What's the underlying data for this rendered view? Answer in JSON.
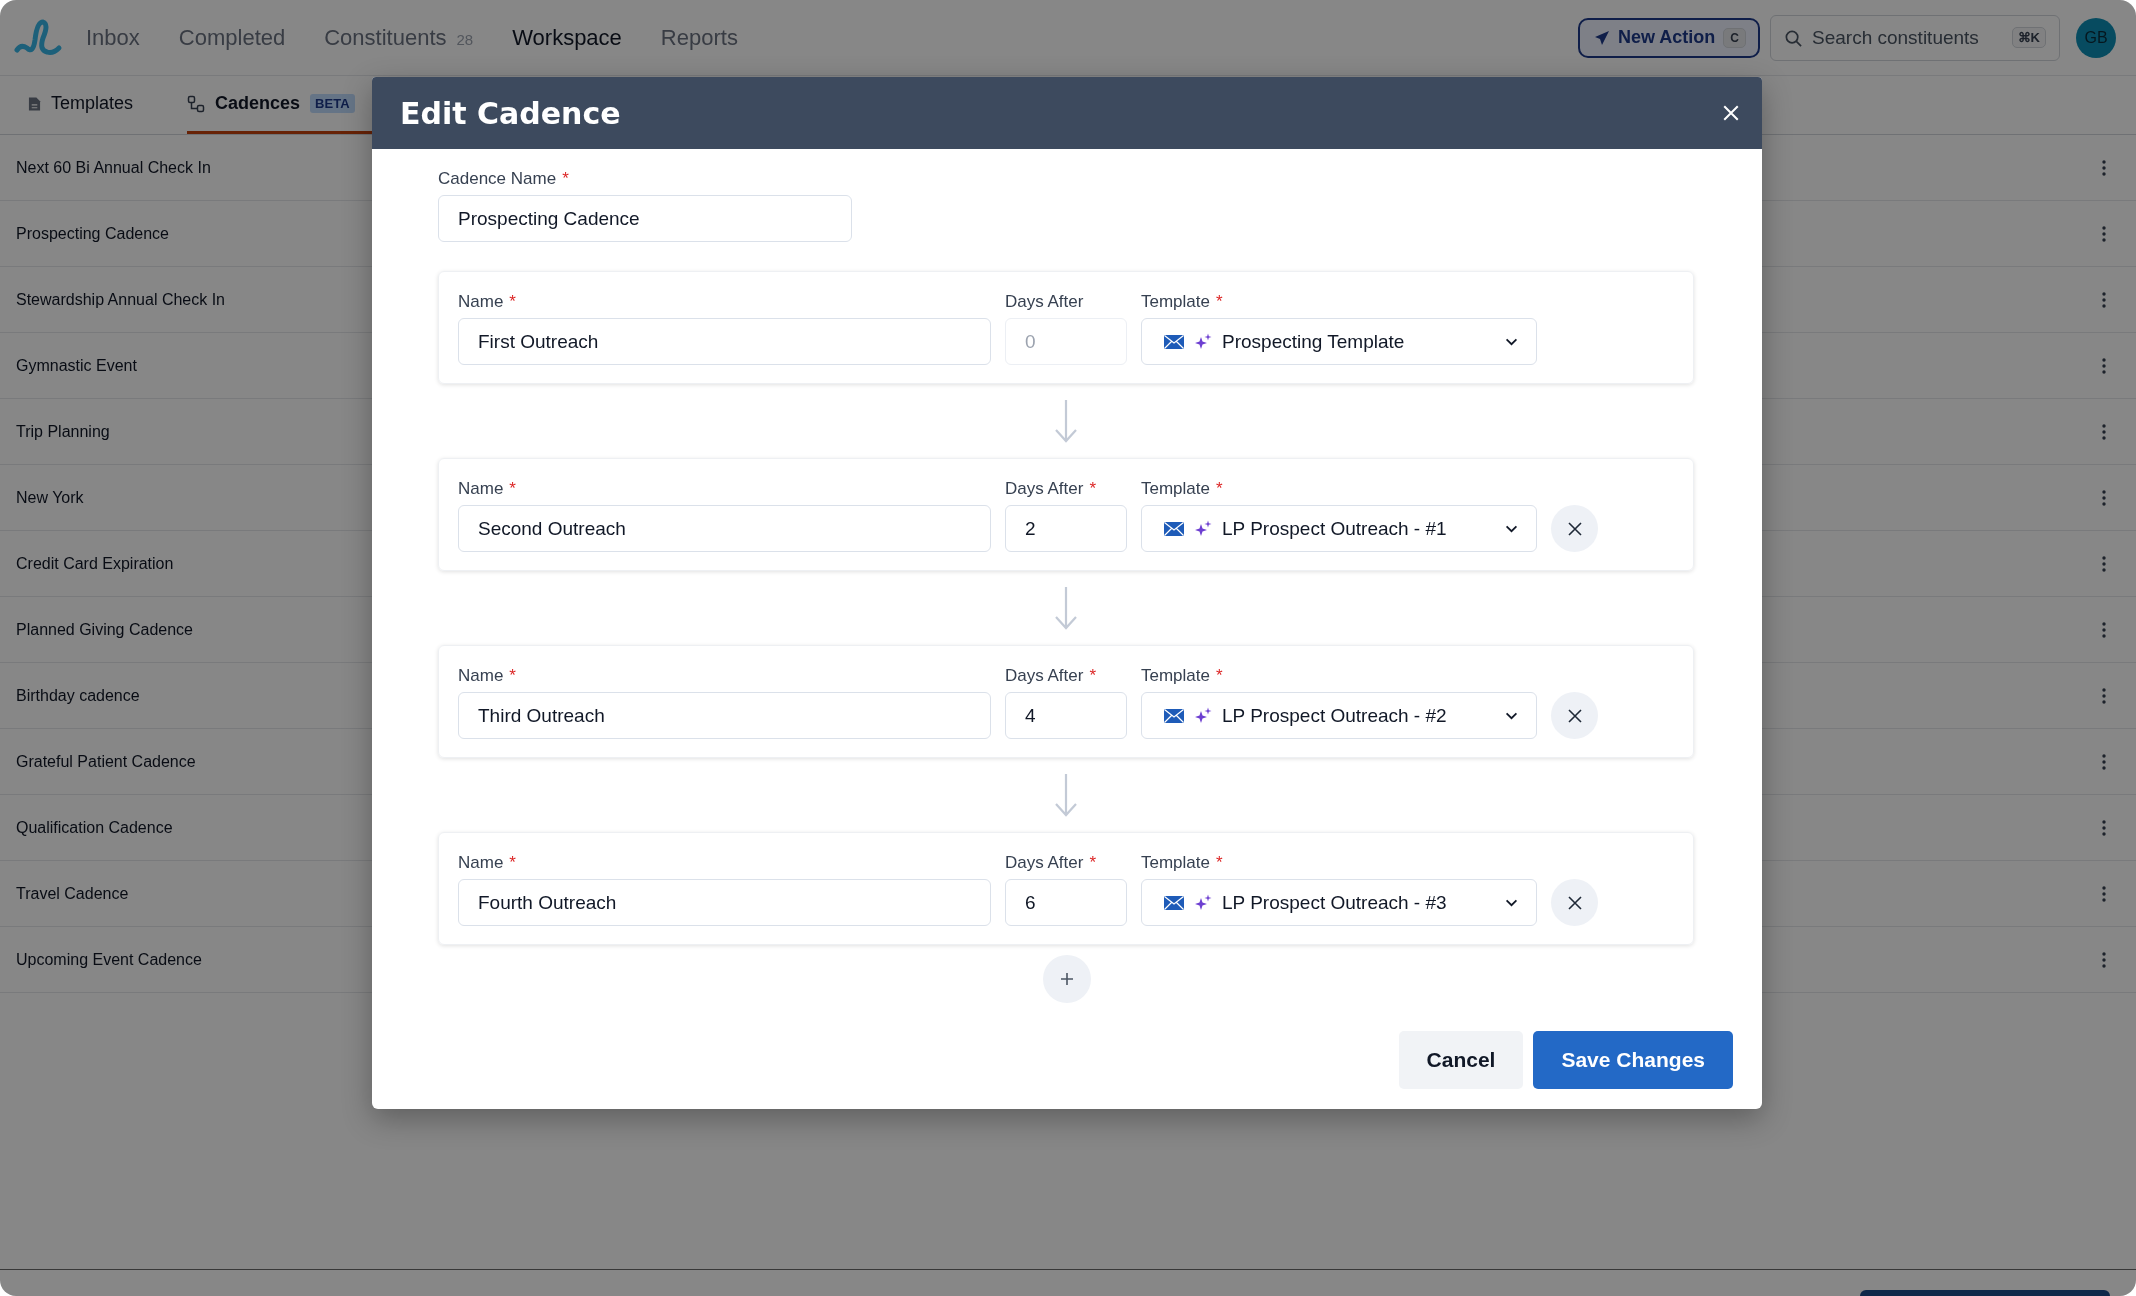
{
  "nav": {
    "items": [
      {
        "label": "Inbox",
        "selected": false
      },
      {
        "label": "Completed",
        "selected": false
      },
      {
        "label": "Constituents",
        "count": "28",
        "selected": false
      },
      {
        "label": "Workspace",
        "selected": true
      },
      {
        "label": "Reports",
        "selected": false
      }
    ],
    "new_action": {
      "label": "New Action",
      "shortcut": "C"
    },
    "search": {
      "placeholder": "Search constituents",
      "shortcut": "⌘K"
    },
    "avatar": "GB"
  },
  "subtabs": [
    {
      "label": "Templates",
      "kind": "document",
      "selected": false
    },
    {
      "label": "Cadences",
      "kind": "flow",
      "badge": "BETA",
      "selected": true
    }
  ],
  "cadences": [
    "Next 60 Bi Annual Check In",
    "Prospecting Cadence",
    "Stewardship Annual Check In",
    "Gymnastic Event",
    "Trip Planning",
    "New York",
    "Credit Card Expiration",
    "Planned Giving Cadence",
    "Birthday cadence",
    "Grateful Patient Cadence",
    "Qualification Cadence",
    "Travel Cadence",
    "Upcoming Event Cadence"
  ],
  "modal": {
    "title": "Edit Cadence",
    "cadence_name": {
      "label": "Cadence Name",
      "mark": "*",
      "value": "Prospecting Cadence"
    },
    "steps": [
      {
        "name_label": "Name",
        "name_mark": "*",
        "name": "First Outreach",
        "days_label": "Days After",
        "days": "0",
        "days_disabled": true,
        "template_label": "Template",
        "template_mark": "*",
        "template": "Prospecting Template",
        "removable": false
      },
      {
        "name_label": "Name",
        "name_mark": "*",
        "name": "Second Outreach",
        "days_label": "Days After",
        "days_mark": "*",
        "days": "2",
        "days_disabled": false,
        "template_label": "Template",
        "template_mark": "*",
        "template": "LP Prospect Outreach - #1",
        "removable": true
      },
      {
        "name_label": "Name",
        "name_mark": "*",
        "name": "Third Outreach",
        "days_label": "Days After",
        "days_mark": "*",
        "days": "4",
        "days_disabled": false,
        "template_label": "Template",
        "template_mark": "*",
        "template": "LP Prospect Outreach - #2",
        "removable": true
      },
      {
        "name_label": "Name",
        "name_mark": "*",
        "name": "Fourth Outreach",
        "days_label": "Days After",
        "days_mark": "*",
        "days": "6",
        "days_disabled": false,
        "template_label": "Template",
        "template_mark": "*",
        "template": "LP Prospect Outreach - #3",
        "removable": true
      }
    ],
    "cancel": "Cancel",
    "save": "Save Changes"
  }
}
